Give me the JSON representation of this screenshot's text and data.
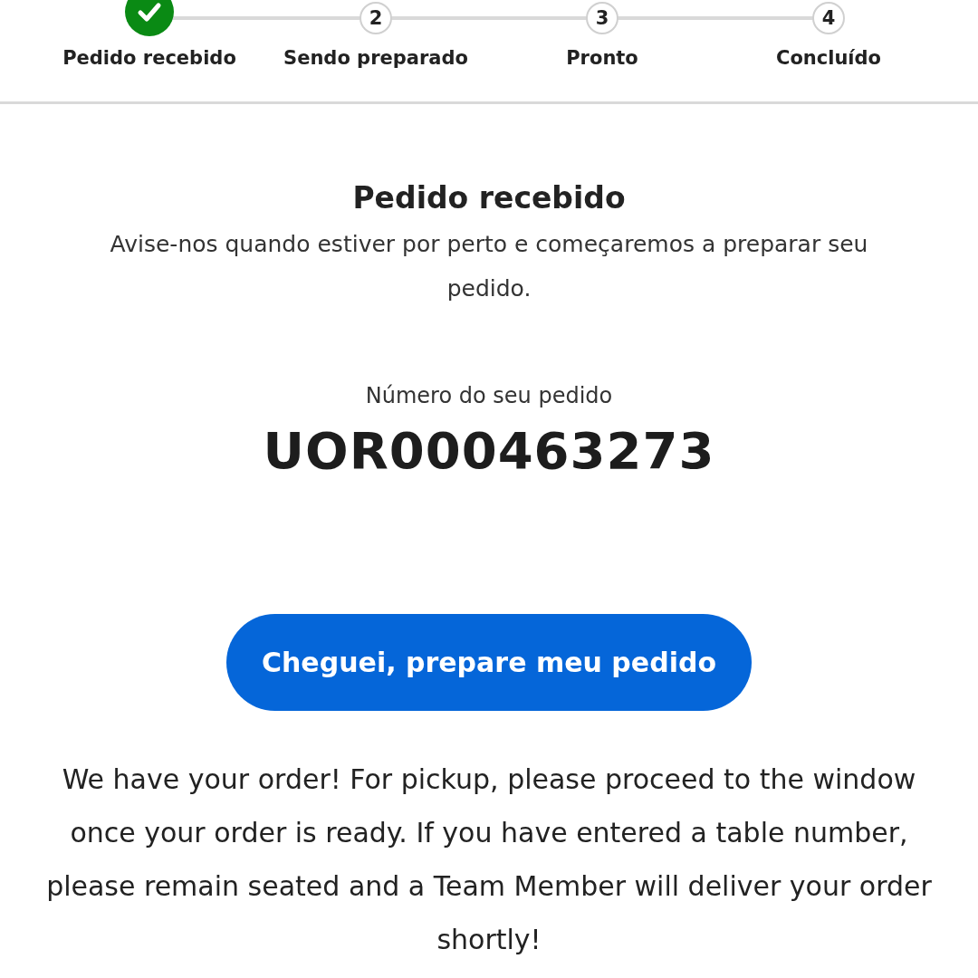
{
  "steps": [
    {
      "label": "Pedido recebido",
      "done": true
    },
    {
      "number": "2",
      "label": "Sendo preparado",
      "done": false
    },
    {
      "number": "3",
      "label": "Pronto",
      "done": false
    },
    {
      "number": "4",
      "label": "Concluído",
      "done": false
    }
  ],
  "status": {
    "title": "Pedido recebido",
    "message": "Avise-nos quando estiver por perto e começaremos a preparar seu pedido."
  },
  "order": {
    "label": "Número do seu pedido",
    "number": "UOR000463273"
  },
  "arrive_button": "Cheguei, prepare meu pedido",
  "note": "We have your order! For pickup, please proceed to the window once your order is ready. If you have entered a table number, please remain seated and a Team Member will deliver your order shortly!"
}
